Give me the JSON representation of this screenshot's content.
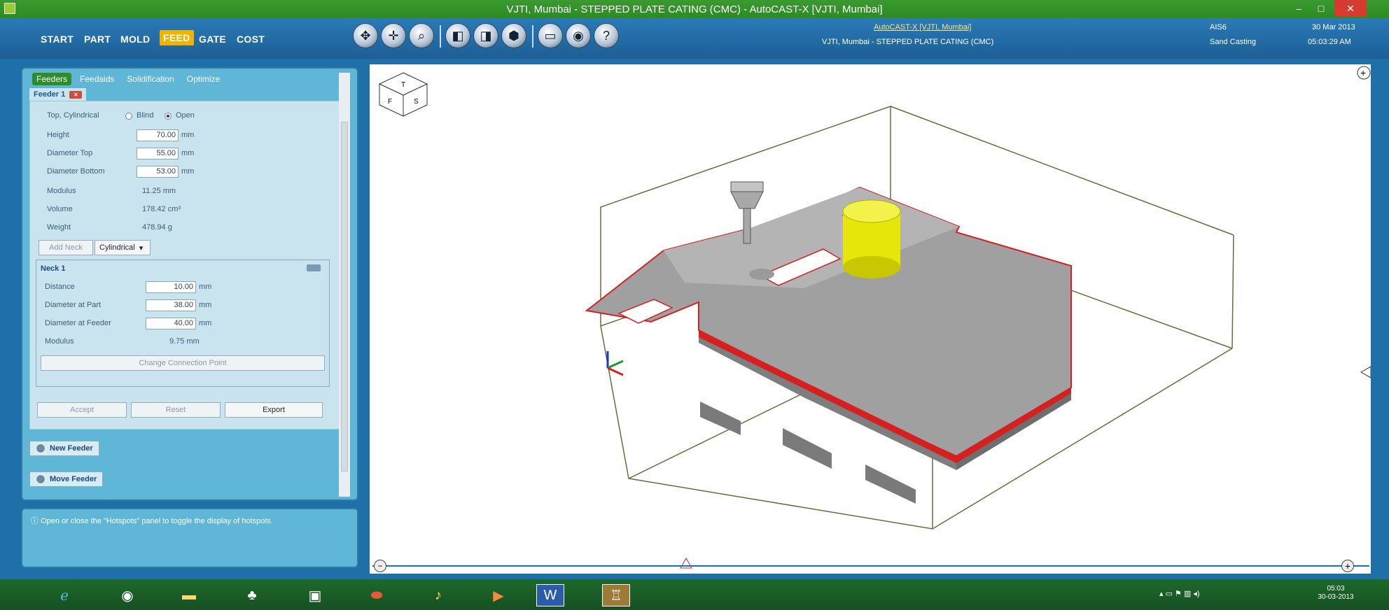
{
  "window": {
    "title": "VJTI, Mumbai - STEPPED PLATE CATING (CMC) - AutoCAST-X [VJTI, Mumbai]",
    "minimize": "–",
    "maximize": "□",
    "close": "✕"
  },
  "menu": {
    "items": [
      "START",
      "PART",
      "MOLD",
      "FEED",
      "GATE",
      "COST"
    ],
    "active": "FEED"
  },
  "header_info": {
    "product_link": "AutoCAST-X [VJTI, Mumbai]",
    "project": "VJTI, Mumbai - STEPPED PLATE CATING (CMC)",
    "material": "AIS6",
    "process": "Sand Casting",
    "date": "30 Mar 2013",
    "time": "05:03:29 AM"
  },
  "side_tabs": [
    "Feeders",
    "Feedaids",
    "Solidification",
    "Optimize"
  ],
  "feeder": {
    "tab_label": "Feeder 1",
    "type": "Top, Cylindrical",
    "blind_label": "Blind",
    "open_label": "Open",
    "selected": "Open",
    "fields": [
      {
        "label": "Height",
        "value": "70.00",
        "unit": "mm"
      },
      {
        "label": "Diameter Top",
        "value": "55.00",
        "unit": "mm"
      },
      {
        "label": "Diameter Bottom",
        "value": "53.00",
        "unit": "mm"
      }
    ],
    "readonly": [
      {
        "label": "Modulus",
        "value": "11.25 mm"
      },
      {
        "label": "Volume",
        "value": "178.42 cm³"
      },
      {
        "label": "Weight",
        "value": "478.94 g"
      }
    ],
    "add_neck_label": "Add Neck",
    "neck_type": "Cylindrical"
  },
  "neck": {
    "title": "Neck 1",
    "fields": [
      {
        "label": "Distance",
        "value": "10.00",
        "unit": "mm"
      },
      {
        "label": "Diameter at Part",
        "value": "38.00",
        "unit": "mm"
      },
      {
        "label": "Diameter at Feeder",
        "value": "40.00",
        "unit": "mm"
      }
    ],
    "modulus_label": "Modulus",
    "modulus_value": "9.75 mm",
    "change_point_label": "Change Connection Point"
  },
  "actions": {
    "accept": "Accept",
    "reset": "Reset",
    "export": "Export",
    "new_feeder": "New Feeder",
    "move_feeder": "Move Feeder"
  },
  "hint": "Open or close the \"Hotspots\" panel to toggle the display of hotspots.",
  "viewcube": {
    "top": "T",
    "front": "F",
    "side": "S"
  },
  "taskbar": {
    "clock_time": "05:03",
    "clock_date": "30-03-2013"
  },
  "colors": {
    "accent": "#1f6fa8",
    "title_green": "#2c8a24",
    "active_menu": "#f0b400",
    "feeder_yellow": "#e6e60a",
    "highlight_red": "#d62020"
  }
}
